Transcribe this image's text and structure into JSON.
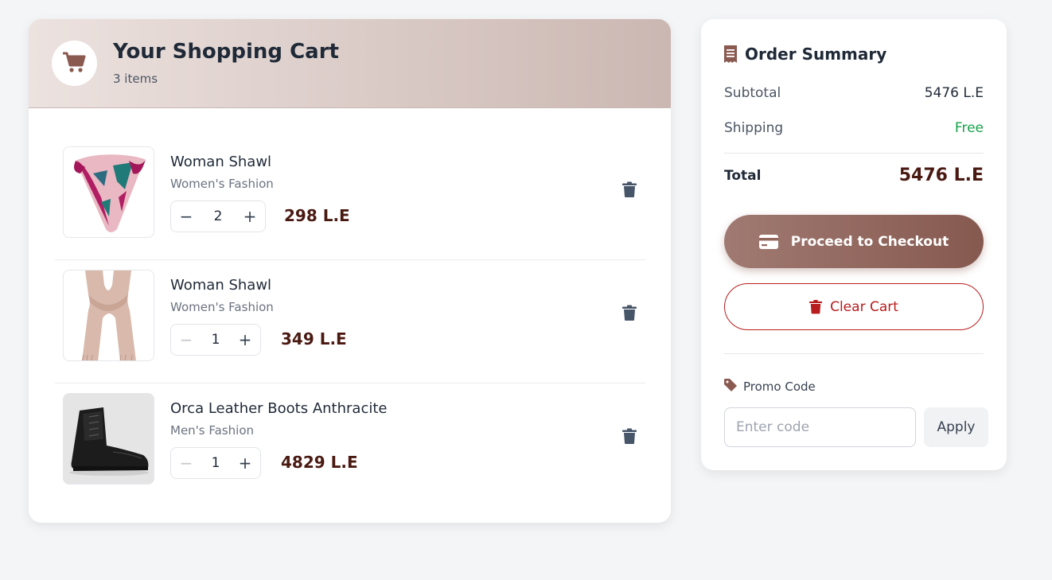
{
  "cart": {
    "title": "Your Shopping Cart",
    "count_label": "3 items",
    "items": [
      {
        "name": "Woman Shawl",
        "category": "Women's Fashion",
        "quantity": "2",
        "price": "298 L.E"
      },
      {
        "name": "Woman Shawl",
        "category": "Women's Fashion",
        "quantity": "1",
        "price": "349 L.E"
      },
      {
        "name": "Orca Leather Boots Anthracite",
        "category": "Men's Fashion",
        "quantity": "1",
        "price": "4829 L.E"
      }
    ],
    "decrement_symbol": "−",
    "increment_symbol": "+"
  },
  "summary": {
    "title": "Order Summary",
    "subtotal_label": "Subtotal",
    "subtotal_value": "5476 L.E",
    "shipping_label": "Shipping",
    "shipping_value": "Free",
    "total_label": "Total",
    "total_value": "5476 L.E",
    "checkout_label": "Proceed to Checkout",
    "clear_label": "Clear Cart",
    "promo_label": "Promo Code",
    "promo_placeholder": "Enter code",
    "apply_label": "Apply"
  },
  "colors": {
    "accent": "#86594f",
    "price": "#4a1a12",
    "danger": "#b91c1c",
    "success": "#16a34a"
  },
  "icons": {
    "cart": "cart-icon",
    "receipt": "receipt-icon",
    "trash": "trash-icon",
    "card": "credit-card-icon",
    "tag": "tag-icon"
  }
}
